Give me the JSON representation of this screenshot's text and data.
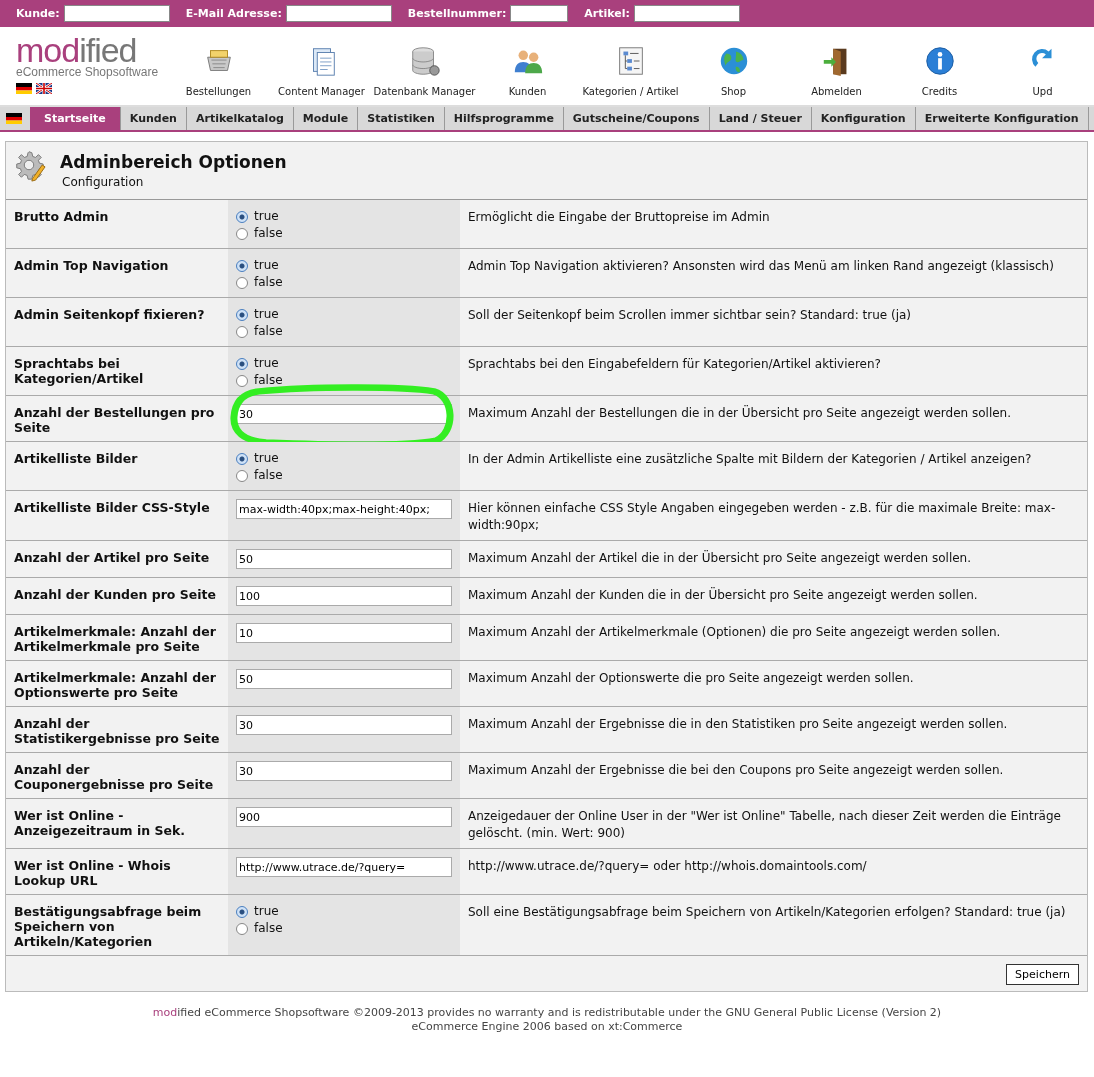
{
  "search_bar": [
    {
      "label": "Kunde:"
    },
    {
      "label": "E-Mail Adresse:"
    },
    {
      "label": "Bestellnummer:"
    },
    {
      "label": "Artikel:"
    }
  ],
  "logo": {
    "accent": "mod",
    "rest": "ified",
    "tagline": "eCommerce Shopsoftware"
  },
  "toolbar": [
    {
      "label": "Bestellungen"
    },
    {
      "label": "Content Manager"
    },
    {
      "label": "Datenbank Manager"
    },
    {
      "label": "Kunden"
    },
    {
      "label": "Kategorien / Artikel"
    },
    {
      "label": "Shop"
    },
    {
      "label": "Abmelden"
    },
    {
      "label": "Credits"
    },
    {
      "label": "Upd"
    }
  ],
  "tabs": [
    {
      "label": "Startseite",
      "selected": true
    },
    {
      "label": "Kunden",
      "selected": false
    },
    {
      "label": "Artikelkatalog",
      "selected": false
    },
    {
      "label": "Module",
      "selected": false
    },
    {
      "label": "Statistiken",
      "selected": false
    },
    {
      "label": "Hilfsprogramme",
      "selected": false
    },
    {
      "label": "Gutscheine/Coupons",
      "selected": false
    },
    {
      "label": "Land / Steuer",
      "selected": false
    },
    {
      "label": "Konfiguration",
      "selected": false
    },
    {
      "label": "Erweiterte Konfiguration",
      "selected": false
    }
  ],
  "page": {
    "title": "Adminbereich Optionen",
    "subtitle": "Configuration"
  },
  "rows": [
    {
      "label": "Brutto Admin",
      "kind": "radio",
      "options": [
        {
          "label": "true",
          "selected": true
        },
        {
          "label": "false",
          "selected": false
        }
      ],
      "description": "Ermöglicht die Eingabe der Bruttopreise im Admin"
    },
    {
      "label": "Admin Top Navigation",
      "kind": "radio",
      "options": [
        {
          "label": "true",
          "selected": true
        },
        {
          "label": "false",
          "selected": false
        }
      ],
      "description": "Admin Top Navigation aktivieren? Ansonsten wird das Menü am linken Rand angezeigt (klassisch)"
    },
    {
      "label": "Admin Seitenkopf fixieren?",
      "kind": "radio",
      "options": [
        {
          "label": "true",
          "selected": true
        },
        {
          "label": "false",
          "selected": false
        }
      ],
      "description": "Soll der Seitenkopf beim Scrollen immer sichtbar sein? Standard: true (ja)"
    },
    {
      "label": "Sprachtabs bei Kategorien/Artikel",
      "kind": "radio",
      "options": [
        {
          "label": "true",
          "selected": true
        },
        {
          "label": "false",
          "selected": false
        }
      ],
      "description": "Sprachtabs bei den Eingabefeldern für Kategorien/Artikel aktivieren?"
    },
    {
      "label": "Anzahl der Bestellungen pro Seite",
      "kind": "text",
      "value": "30",
      "description": "Maximum Anzahl der Bestellungen die in der Übersicht pro Seite angezeigt werden sollen.",
      "circled": true
    },
    {
      "label": "Artikelliste Bilder",
      "kind": "radio",
      "options": [
        {
          "label": "true",
          "selected": true
        },
        {
          "label": "false",
          "selected": false
        }
      ],
      "description": "In der Admin Artikelliste eine zusätzliche Spalte mit Bildern der Kategorien / Artikel anzeigen?"
    },
    {
      "label": "Artikelliste Bilder CSS-Style",
      "kind": "text",
      "value": "max-width:40px;max-height:40px;",
      "description": "Hier können einfache CSS Style Angaben eingegeben werden - z.B. für die maximale Breite: max-width:90px;"
    },
    {
      "label": "Anzahl der Artikel pro Seite",
      "kind": "text",
      "value": "50",
      "description": "Maximum Anzahl der Artikel die in der Übersicht pro Seite angezeigt werden sollen."
    },
    {
      "label": "Anzahl der Kunden pro Seite",
      "kind": "text",
      "value": "100",
      "description": "Maximum Anzahl der Kunden die in der Übersicht pro Seite angezeigt werden sollen."
    },
    {
      "label": "Artikelmerkmale: Anzahl der Artikelmerkmale pro Seite",
      "kind": "text",
      "value": "10",
      "description": "Maximum Anzahl der Artikelmerkmale (Optionen) die pro Seite angezeigt werden sollen."
    },
    {
      "label": "Artikelmerkmale: Anzahl der Optionswerte pro Seite",
      "kind": "text",
      "value": "50",
      "description": "Maximum Anzahl der Optionswerte die pro Seite angezeigt werden sollen."
    },
    {
      "label": "Anzahl der Statistikergebnisse pro Seite",
      "kind": "text",
      "value": "30",
      "description": "Maximum Anzahl der Ergebnisse die in den Statistiken pro Seite angezeigt werden sollen."
    },
    {
      "label": "Anzahl der Couponergebnisse pro Seite",
      "kind": "text",
      "value": "30",
      "description": "Maximum Anzahl der Ergebnisse die bei den Coupons pro Seite angezeigt werden sollen."
    },
    {
      "label": "Wer ist Online - Anzeigezeitraum in Sek.",
      "kind": "text",
      "value": "900",
      "description": "Anzeigedauer der Online User in der \"Wer ist Online\" Tabelle, nach dieser Zeit werden die Einträge gelöscht. (min. Wert: 900)"
    },
    {
      "label": "Wer ist Online - Whois Lookup URL",
      "kind": "text",
      "value": "http://www.utrace.de/?query=",
      "description": "http://www.utrace.de/?query= oder http://whois.domaintools.com/"
    },
    {
      "label": "Bestätigungsabfrage beim Speichern von Artikeln/Kategorien",
      "kind": "radio",
      "options": [
        {
          "label": "true",
          "selected": true
        },
        {
          "label": "false",
          "selected": false
        }
      ],
      "description": "Soll eine Bestätigungsabfrage beim Speichern von Artikeln/Kategorien erfolgen? Standard: true (ja)"
    }
  ],
  "save_button": "Speichern",
  "footer": {
    "accent": "mod",
    "line1": "ified eCommerce Shopsoftware ©2009-2013 provides no warranty and is redistributable under the GNU General Public License (Version 2)",
    "line2": "eCommerce Engine 2006 based on xt:Commerce"
  }
}
